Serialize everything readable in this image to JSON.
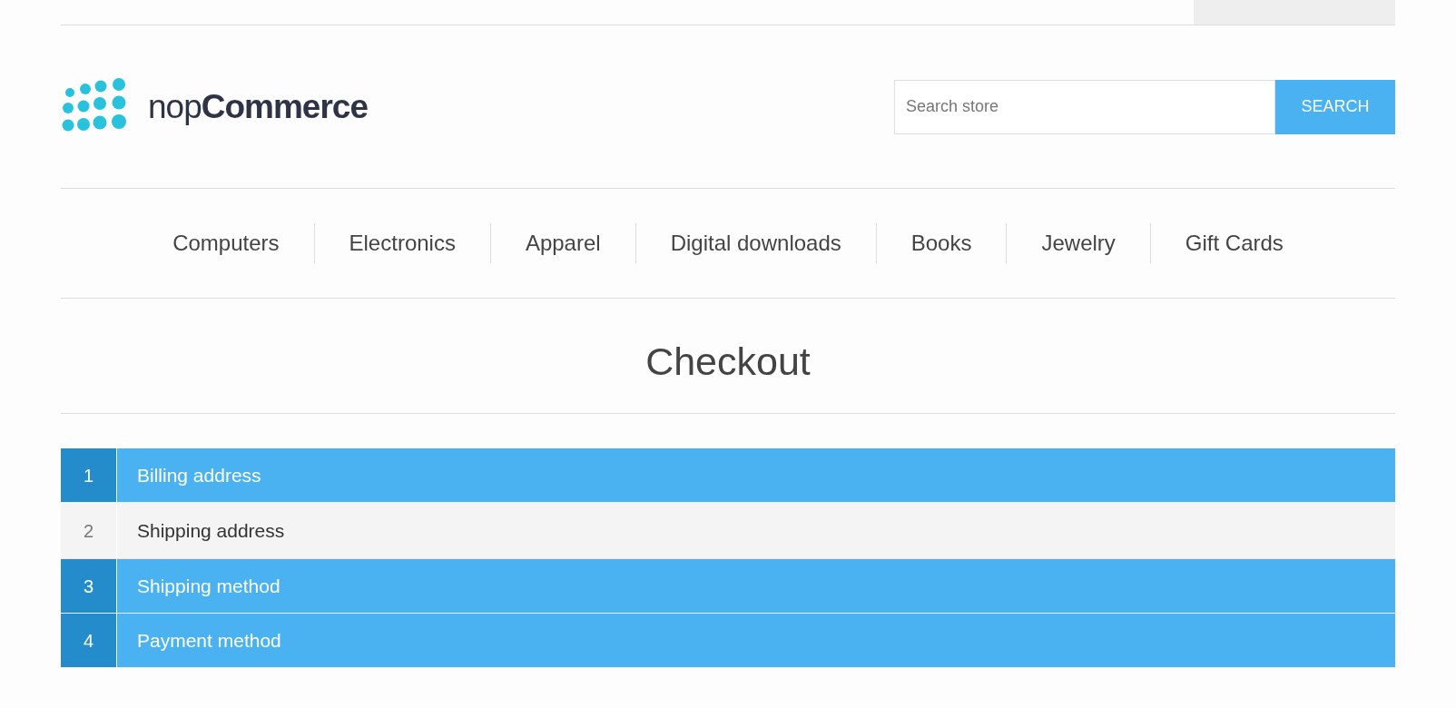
{
  "logo": {
    "text": "nop**Commerce**"
  },
  "search": {
    "placeholder": "Search store",
    "button": "SEARCH"
  },
  "menu": [
    "Computers",
    "Electronics",
    "Apparel",
    "Digital downloads",
    "Books",
    "Jewelry",
    "Gift Cards"
  ],
  "page_title": "Checkout",
  "steps": [
    {
      "number": "1",
      "title": "Billing address",
      "enabled": true
    },
    {
      "number": "2",
      "title": "Shipping address",
      "enabled": false
    },
    {
      "number": "3",
      "title": "Shipping method",
      "enabled": true
    },
    {
      "number": "4",
      "title": "Payment method",
      "enabled": true
    }
  ]
}
